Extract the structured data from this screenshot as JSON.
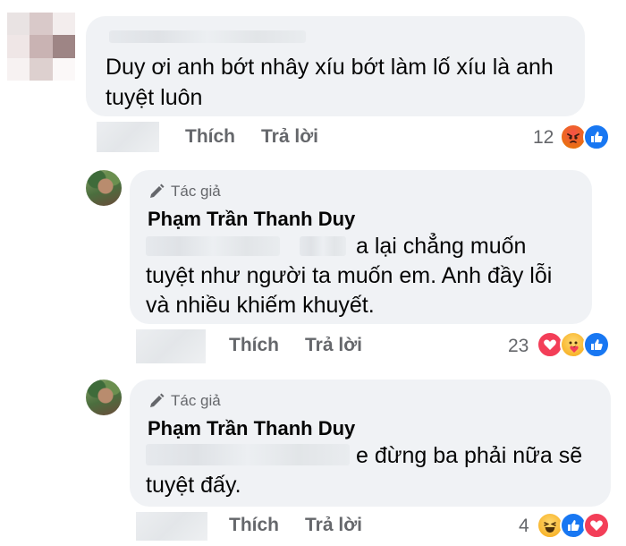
{
  "comments": [
    {
      "text_line1": "Duy ơi anh bớt nhây xíu bớt làm lố xíu là anh",
      "text_line2": "tuyệt luôn",
      "like": "Thích",
      "reply": "Trả lời",
      "reaction_count": "12",
      "reactions": [
        "angry-icon",
        "like-icon"
      ]
    },
    {
      "badge": "Tác giả",
      "author": "Phạm Trần Thanh Duy",
      "text_line1": "a lại chẳng muốn",
      "text_line2": "tuyệt như người ta muốn em. Anh đầy lỗi",
      "text_line3": "và nhiều khiếm khuyết.",
      "like": "Thích",
      "reply": "Trả lời",
      "reaction_count": "23",
      "reactions": [
        "love-icon",
        "care-icon",
        "like-icon"
      ]
    },
    {
      "badge": "Tác giả",
      "author": "Phạm Trần Thanh Duy",
      "text_line1": "e đừng ba phải nữa sẽ",
      "text_line2": "tuyệt đấy.",
      "like": "Thích",
      "reply": "Trả lời",
      "reaction_count": "4",
      "reactions": [
        "haha-icon",
        "like-icon",
        "love-icon"
      ]
    }
  ],
  "colors": {
    "bubble": "#f0f2f5",
    "secondary_text": "#65676b",
    "like_blue": "#1877f2",
    "love_red": "#f33e58",
    "angry_orange": "#e9710f"
  }
}
